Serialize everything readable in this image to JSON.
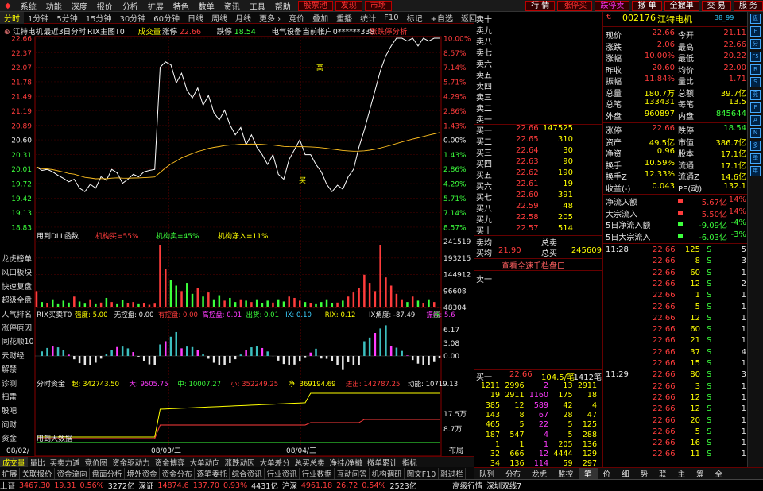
{
  "menu": {
    "items": [
      "系统",
      "功能",
      "深度",
      "报价",
      "分析",
      "扩展",
      "特色",
      "数单",
      "资讯",
      "工具",
      "帮助"
    ],
    "highlight": [
      "股票池",
      "发现",
      "市场"
    ],
    "right": [
      "行 情",
      "涨停买",
      "跌停卖",
      "撤 单",
      "全撤单",
      "交 易",
      "服 务"
    ]
  },
  "tabs": [
    "分时",
    "1分钟",
    "5分钟",
    "15分钟",
    "30分钟",
    "60分钟",
    "日线",
    "周线",
    "月线",
    "更多 ›",
    "竞价",
    "叠加",
    "重播",
    "统计",
    "F10",
    "标记",
    "+自选",
    "返回"
  ],
  "chart": {
    "stock_name": "江特电机",
    "range_label": "最近3日分时",
    "indicator_main": "RIX主图T0",
    "cjl_label": "成交量",
    "zd_label": "涨停",
    "zd_value": "22.66",
    "dt_label": "跌停",
    "dt_value": "18.54",
    "industry": "电气设备",
    "account": "当前帐户",
    "account_no": "0******338",
    "zdt_analysis": "涨跌停分析",
    "price_ticks": [
      "22.66",
      "22.37",
      "22.07",
      "21.78",
      "21.49",
      "21.19",
      "20.89",
      "20.60",
      "20.31",
      "20.01",
      "19.72",
      "19.42",
      "19.13",
      "18.83"
    ],
    "pct_ticks": [
      "10.00%",
      "8.57%",
      "7.14%",
      "5.71%",
      "4.29%",
      "2.86%",
      "1.43%",
      "0.00%",
      "1.43%",
      "2.86%",
      "4.29%",
      "5.71%",
      "7.14%",
      "8.57%"
    ],
    "mark_gao": "高",
    "mark_mai": "买",
    "dll_label": "用到DLL函数",
    "jg_buy": "机构买=55%",
    "jg_sell": "机构卖=45%",
    "jg_net": "机构净入=11%",
    "vol_ticks": [
      "241519",
      "193215",
      "144912",
      "96608",
      "48304"
    ],
    "rix_title": "RIX买卖T0",
    "rix_items": [
      {
        "k": "强度:",
        "v": "5.00",
        "c": "#ffff00"
      },
      {
        "k": "无控盘:",
        "v": "0.00",
        "c": "#e8e8e8"
      },
      {
        "k": "有控盘:",
        "v": "0.00",
        "c": "#ff3c3c"
      },
      {
        "k": "高控盘:",
        "v": "0.01",
        "c": "#ff3cff"
      },
      {
        "k": "出货:",
        "v": "0.01",
        "c": "#3cff3c"
      },
      {
        "k": "IX:",
        "v": "0.10",
        "c": "#3ccfff"
      },
      {
        "k": "RIX:",
        "v": "0.12",
        "c": "#ffff00"
      },
      {
        "k": "IX角度:",
        "v": "-87.49",
        "c": "#e8e8e8"
      },
      {
        "k": "振幅:",
        "v": "5.6",
        "c": "#ff3cff"
      }
    ],
    "rix_extra": "涨",
    "rix_ticks": [
      "6.17",
      "3.08",
      "0.00"
    ],
    "zj_title": "分时资金",
    "zj_items": [
      {
        "k": "超:",
        "v": "342743.50",
        "c": "#ffff00"
      },
      {
        "k": "大:",
        "v": "9505.75",
        "c": "#ff3cff"
      },
      {
        "k": "中:",
        "v": "10007.27",
        "c": "#3cff3c"
      },
      {
        "k": "小:",
        "v": "352249.25",
        "c": "#ff3c3c"
      },
      {
        "k": "净:",
        "v": "369194.69",
        "c": "#ffff00"
      },
      {
        "k": "进出:",
        "v": "142787.25",
        "c": "#ff3c3c"
      },
      {
        "k": "动能:",
        "v": "10719.13",
        "c": "#e8e8e8"
      }
    ],
    "zj_ticks": [
      "17.5万",
      "8.7万"
    ],
    "zj_note": "用到大数据",
    "dates": [
      "08/02/一",
      "08/03/二",
      "08/04/三"
    ],
    "layout_label": "布局"
  },
  "left_nav": [
    "龙虎榜单",
    "风口板块",
    "快速复盘",
    "超级全盘",
    "人气排名",
    "涨停原因",
    "同花顺10",
    "云财经",
    "解禁",
    "诊测",
    "扫雷",
    "股吧",
    "问财",
    "资金"
  ],
  "bottom_tabs": [
    "成交量",
    "量比",
    "买卖力道",
    "竞价图",
    "资金驱动力",
    "资金博弈",
    "大单动向",
    "涨跌动因",
    "大单差分",
    "总买总卖",
    "净挂/净撤",
    "撤单累计",
    "指标"
  ],
  "bottom_tabs2": [
    "扩展",
    "关联报价",
    "资金流向",
    "盘面分析",
    "境外资金",
    "资金分布",
    "逐笔委托",
    "综合资讯",
    "行业资讯",
    "行业数据",
    "互动问答",
    "机构调研",
    "图文F10",
    "融过栏"
  ],
  "orderbook": {
    "sell": [
      {
        "l": "卖十",
        "p": "",
        "v": ""
      },
      {
        "l": "卖九",
        "p": "",
        "v": ""
      },
      {
        "l": "卖八",
        "p": "",
        "v": ""
      },
      {
        "l": "卖七",
        "p": "",
        "v": ""
      },
      {
        "l": "卖六",
        "p": "",
        "v": ""
      },
      {
        "l": "卖五",
        "p": "",
        "v": ""
      },
      {
        "l": "卖四",
        "p": "",
        "v": ""
      },
      {
        "l": "卖三",
        "p": "",
        "v": ""
      },
      {
        "l": "卖二",
        "p": "",
        "v": ""
      },
      {
        "l": "卖一",
        "p": "",
        "v": ""
      }
    ],
    "buy": [
      {
        "l": "买一",
        "p": "22.66",
        "v": "147525"
      },
      {
        "l": "买二",
        "p": "22.65",
        "v": "310"
      },
      {
        "l": "买三",
        "p": "22.64",
        "v": "30"
      },
      {
        "l": "买四",
        "p": "22.63",
        "v": "90"
      },
      {
        "l": "买五",
        "p": "22.62",
        "v": "190"
      },
      {
        "l": "买六",
        "p": "22.61",
        "v": "19"
      },
      {
        "l": "买七",
        "p": "22.60",
        "v": "391"
      },
      {
        "l": "买八",
        "p": "22.59",
        "v": "48"
      },
      {
        "l": "买九",
        "p": "22.58",
        "v": "205"
      },
      {
        "l": "买十",
        "p": "22.57",
        "v": "514"
      }
    ],
    "avg_sell_label": "卖均",
    "total_sell_label": "总卖",
    "avg_buy_label": "买均",
    "avg_buy": "21.90",
    "total_buy_label": "总买",
    "total_buy": "245609",
    "view_all": "查看全速千档盘口",
    "s1_label": "卖一",
    "b1_label": "买一",
    "b1_price": "22.66",
    "b1_info": "104.5/笔",
    "b1_count": "1412笔",
    "queue": [
      [
        "1211",
        "2996",
        "2",
        "13",
        "2911"
      ],
      [
        "19",
        "2911",
        "1160",
        "175",
        "18"
      ],
      [
        "385",
        "12",
        "589",
        "42",
        "4"
      ],
      [
        "143",
        "8",
        "67",
        "28",
        "47"
      ],
      [
        "465",
        "5",
        "22",
        "5",
        "125"
      ],
      [
        "187",
        "547",
        "4",
        "5",
        "288"
      ],
      [
        "1",
        "1",
        "1",
        "205",
        "136"
      ],
      [
        "32",
        "666",
        "12",
        "4444",
        "129"
      ],
      [
        "34",
        "136",
        "114",
        "59",
        "297"
      ]
    ]
  },
  "quote": {
    "code": "002176",
    "name": "江特电机",
    "tag": "38_99",
    "rows": [
      [
        "现价",
        "22.66",
        "今开",
        "21.11"
      ],
      [
        "涨跌",
        "2.06",
        "最高",
        "22.66"
      ],
      [
        "涨幅",
        "10.00%",
        "最低",
        "20.22"
      ],
      [
        "昨收",
        "20.60",
        "均价",
        "22.00"
      ],
      [
        "振幅",
        "11.84%",
        "量比",
        "1.71"
      ],
      [
        "总量",
        "180.7万",
        "总额",
        "39.7亿"
      ],
      [
        "总笔",
        "133431",
        "每笔",
        "13.5"
      ],
      [
        "外盘",
        "960897",
        "内盘",
        "845644"
      ]
    ],
    "rows2": [
      [
        "涨停",
        "22.66",
        "跌停",
        "18.54"
      ],
      [
        "资产",
        "49.5亿",
        "市值",
        "386.7亿"
      ],
      [
        "净资",
        "0.96",
        "股本",
        "17.1亿"
      ],
      [
        "换手",
        "10.59%",
        "流通",
        "17.1亿"
      ],
      [
        "换手Z",
        "12.33%",
        "流通Z",
        "14.6亿"
      ],
      [
        "收益(-)",
        "0.043",
        "PE(动)",
        "132.1"
      ]
    ],
    "flows": [
      {
        "k": "净流入额",
        "v": "5.67亿",
        "p": "14%",
        "c": "#ff3c3c"
      },
      {
        "k": "大宗流入",
        "v": "5.50亿",
        "p": "14%",
        "c": "#ff3c3c"
      },
      {
        "k": "5日净流入额",
        "v": "-9.09亿",
        "p": "-4%",
        "c": "#3cff3c"
      },
      {
        "k": "5日大宗流入",
        "v": "-6.03亿",
        "p": "-3%",
        "c": "#3cff3c"
      }
    ],
    "ticks": [
      {
        "t": "11:28",
        "p": "22.66",
        "v": "125",
        "s": "S",
        "n": "5"
      },
      {
        "t": "",
        "p": "22.66",
        "v": "8",
        "s": "S",
        "n": "3"
      },
      {
        "t": "",
        "p": "22.66",
        "v": "60",
        "s": "S",
        "n": "1"
      },
      {
        "t": "",
        "p": "22.66",
        "v": "12",
        "s": "S",
        "n": "2"
      },
      {
        "t": "",
        "p": "22.66",
        "v": "1",
        "s": "S",
        "n": "1"
      },
      {
        "t": "",
        "p": "22.66",
        "v": "5",
        "s": "S",
        "n": "1"
      },
      {
        "t": "",
        "p": "22.66",
        "v": "12",
        "s": "S",
        "n": "1"
      },
      {
        "t": "",
        "p": "22.66",
        "v": "60",
        "s": "S",
        "n": "1"
      },
      {
        "t": "",
        "p": "22.66",
        "v": "21",
        "s": "S",
        "n": "1"
      },
      {
        "t": "",
        "p": "22.66",
        "v": "37",
        "s": "S",
        "n": "4"
      },
      {
        "t": "",
        "p": "22.66",
        "v": "15",
        "s": "S",
        "n": "1"
      },
      {
        "t": "11:29",
        "p": "22.66",
        "v": "80",
        "s": "S",
        "n": "3"
      },
      {
        "t": "",
        "p": "22.66",
        "v": "3",
        "s": "S",
        "n": "1"
      },
      {
        "t": "",
        "p": "22.66",
        "v": "12",
        "s": "S",
        "n": "1"
      },
      {
        "t": "",
        "p": "22.66",
        "v": "12",
        "s": "S",
        "n": "1"
      },
      {
        "t": "",
        "p": "22.66",
        "v": "20",
        "s": "S",
        "n": "1"
      },
      {
        "t": "",
        "p": "22.66",
        "v": "5",
        "s": "S",
        "n": "1"
      },
      {
        "t": "",
        "p": "22.66",
        "v": "16",
        "s": "S",
        "n": "1"
      },
      {
        "t": "",
        "p": "22.66",
        "v": "11",
        "s": "S",
        "n": "1"
      }
    ]
  },
  "quote_tabs": [
    "队列",
    "分布",
    "龙虎",
    "监控",
    "笔",
    "价",
    "细",
    "势",
    "联",
    "主",
    "筹",
    "全"
  ],
  "right_side": [
    "盘",
    "F",
    "分",
    "F5",
    "R",
    "S",
    "竞",
    "F",
    "A",
    "N",
    "多",
    "季",
    "年"
  ],
  "status": {
    "sh_label": "上证",
    "sh_v": "3467.30",
    "sh_c": "19.31",
    "sh_p": "0.56%",
    "sh_a": "3272亿",
    "sz_label": "深证",
    "sz_v": "14874.6",
    "sz_c": "137.70",
    "sz_p": "0.93%",
    "sz_a": "4431亿",
    "hs_label": "沪深",
    "hs_v": "4961.18",
    "hs_c": "26.72",
    "hs_p": "0.54%",
    "hs_a": "2523亿",
    "feed": "高级行情",
    "feed2": "深圳双线7"
  },
  "colors": {
    "up": "#ff3c3c",
    "down": "#3cff3c",
    "price": "#ffffff",
    "avg": "#ffff00",
    "frame": "#880000"
  }
}
